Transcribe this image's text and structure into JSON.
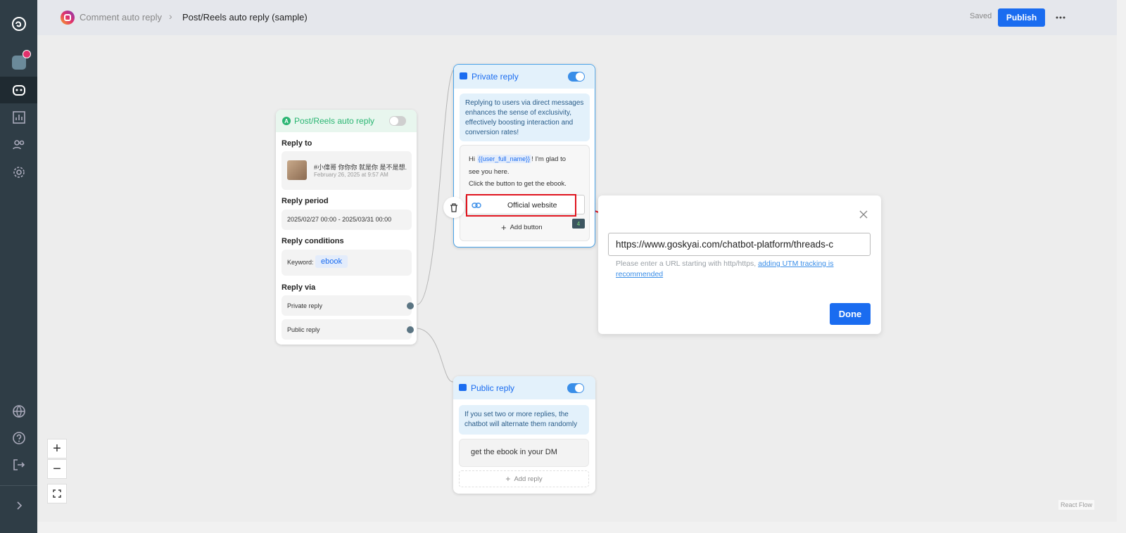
{
  "breadcrumb": {
    "parent": "Comment auto reply",
    "current": "Post/Reels auto reply (sample)"
  },
  "header": {
    "status": "Saved",
    "publish_label": "Publish"
  },
  "trigger": {
    "title": "Post/Reels auto reply",
    "reply_to_label": "Reply to",
    "post_text": "#小偉哥 你你你 就是你 是不是想...",
    "post_date": "February 26, 2025 at 9:57 AM",
    "reply_period_label": "Reply period",
    "reply_period_value": "2025/02/27 00:00 - 2025/03/31 00:00",
    "conditions_label": "Reply conditions",
    "keyword_label": "Keyword:",
    "keyword": "ebook",
    "reply_via_label": "Reply via",
    "via": [
      "Private reply",
      "Public reply"
    ]
  },
  "private_reply": {
    "title": "Private reply",
    "info": "Replying to users via direct messages enhances the sense of exclusivity, effectively boosting interaction and conversion rates!",
    "msg_hi": "Hi",
    "msg_var": "{{user_full_name}}",
    "msg_line1_rest": "! I'm glad to",
    "msg_line2": "see you here.",
    "msg_line3": "Click the button to get the ebook.",
    "button_label": "Official website",
    "badge": "4",
    "add_button": "Add button"
  },
  "url_popup": {
    "url_value": "https://www.goskyai.com/chatbot-platform/threads-c",
    "hint": "Please enter a URL starting with http/https,",
    "hint_link_1": "adding UTM tracking is",
    "hint_link_2": "recommended",
    "done_label": "Done"
  },
  "public_reply": {
    "title": "Public reply",
    "info": "If you set two or more replies, the chatbot will alternate them randomly",
    "message": "get the ebook in your DM",
    "add_reply": "Add reply"
  },
  "zoom": {
    "plus": "+",
    "minus": "−"
  },
  "attribution": "React Flow",
  "colors": {
    "accent": "#1a6cf0",
    "trigger": "#2bb673",
    "sidebar": "#2f3d46",
    "highlight": "#e0141e"
  }
}
